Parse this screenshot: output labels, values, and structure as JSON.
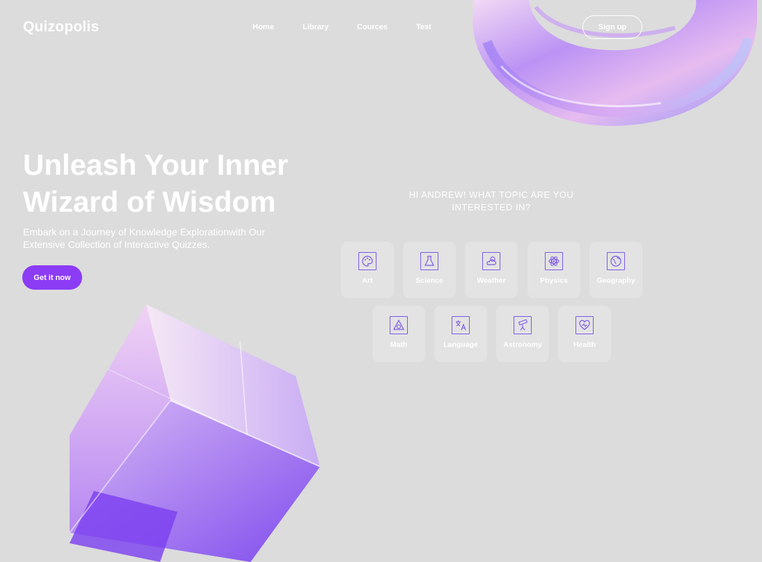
{
  "brand": {
    "name": "Quizopolis"
  },
  "nav": {
    "items": [
      "Home",
      "Library",
      "Cources",
      "Test"
    ]
  },
  "header": {
    "signup_label": "Sign up"
  },
  "hero": {
    "title_line1": "Unleash Your Inner",
    "title_line2": "Wizard of Wisdom",
    "subtitle_line1": "Embark on a Journey of Knowledge Explorationwith Our",
    "subtitle_line2": "Extensive Collection of Interactive Quizzes.",
    "cta_label": "Get it now"
  },
  "topics": {
    "question_line1": "HI ANDREW! WHAT TOPIC ARE YOU",
    "question_line2": "INTERESTED IN?",
    "items": [
      {
        "label": "Art",
        "icon": "palette-icon"
      },
      {
        "label": "Science",
        "icon": "flask-icon"
      },
      {
        "label": "Weather",
        "icon": "cloud-sun-icon"
      },
      {
        "label": "Physics",
        "icon": "atom-icon"
      },
      {
        "label": "Geography",
        "icon": "globe-icon"
      },
      {
        "label": "Math",
        "icon": "shapes-icon"
      },
      {
        "label": "Language",
        "icon": "translate-icon"
      },
      {
        "label": "Astronomy",
        "icon": "telescope-icon"
      },
      {
        "label": "Health",
        "icon": "heart-icon"
      }
    ]
  },
  "colors": {
    "accent": "#8c3cf5",
    "icon_stroke": "#7b58e6",
    "background": "#dcdcdc"
  }
}
